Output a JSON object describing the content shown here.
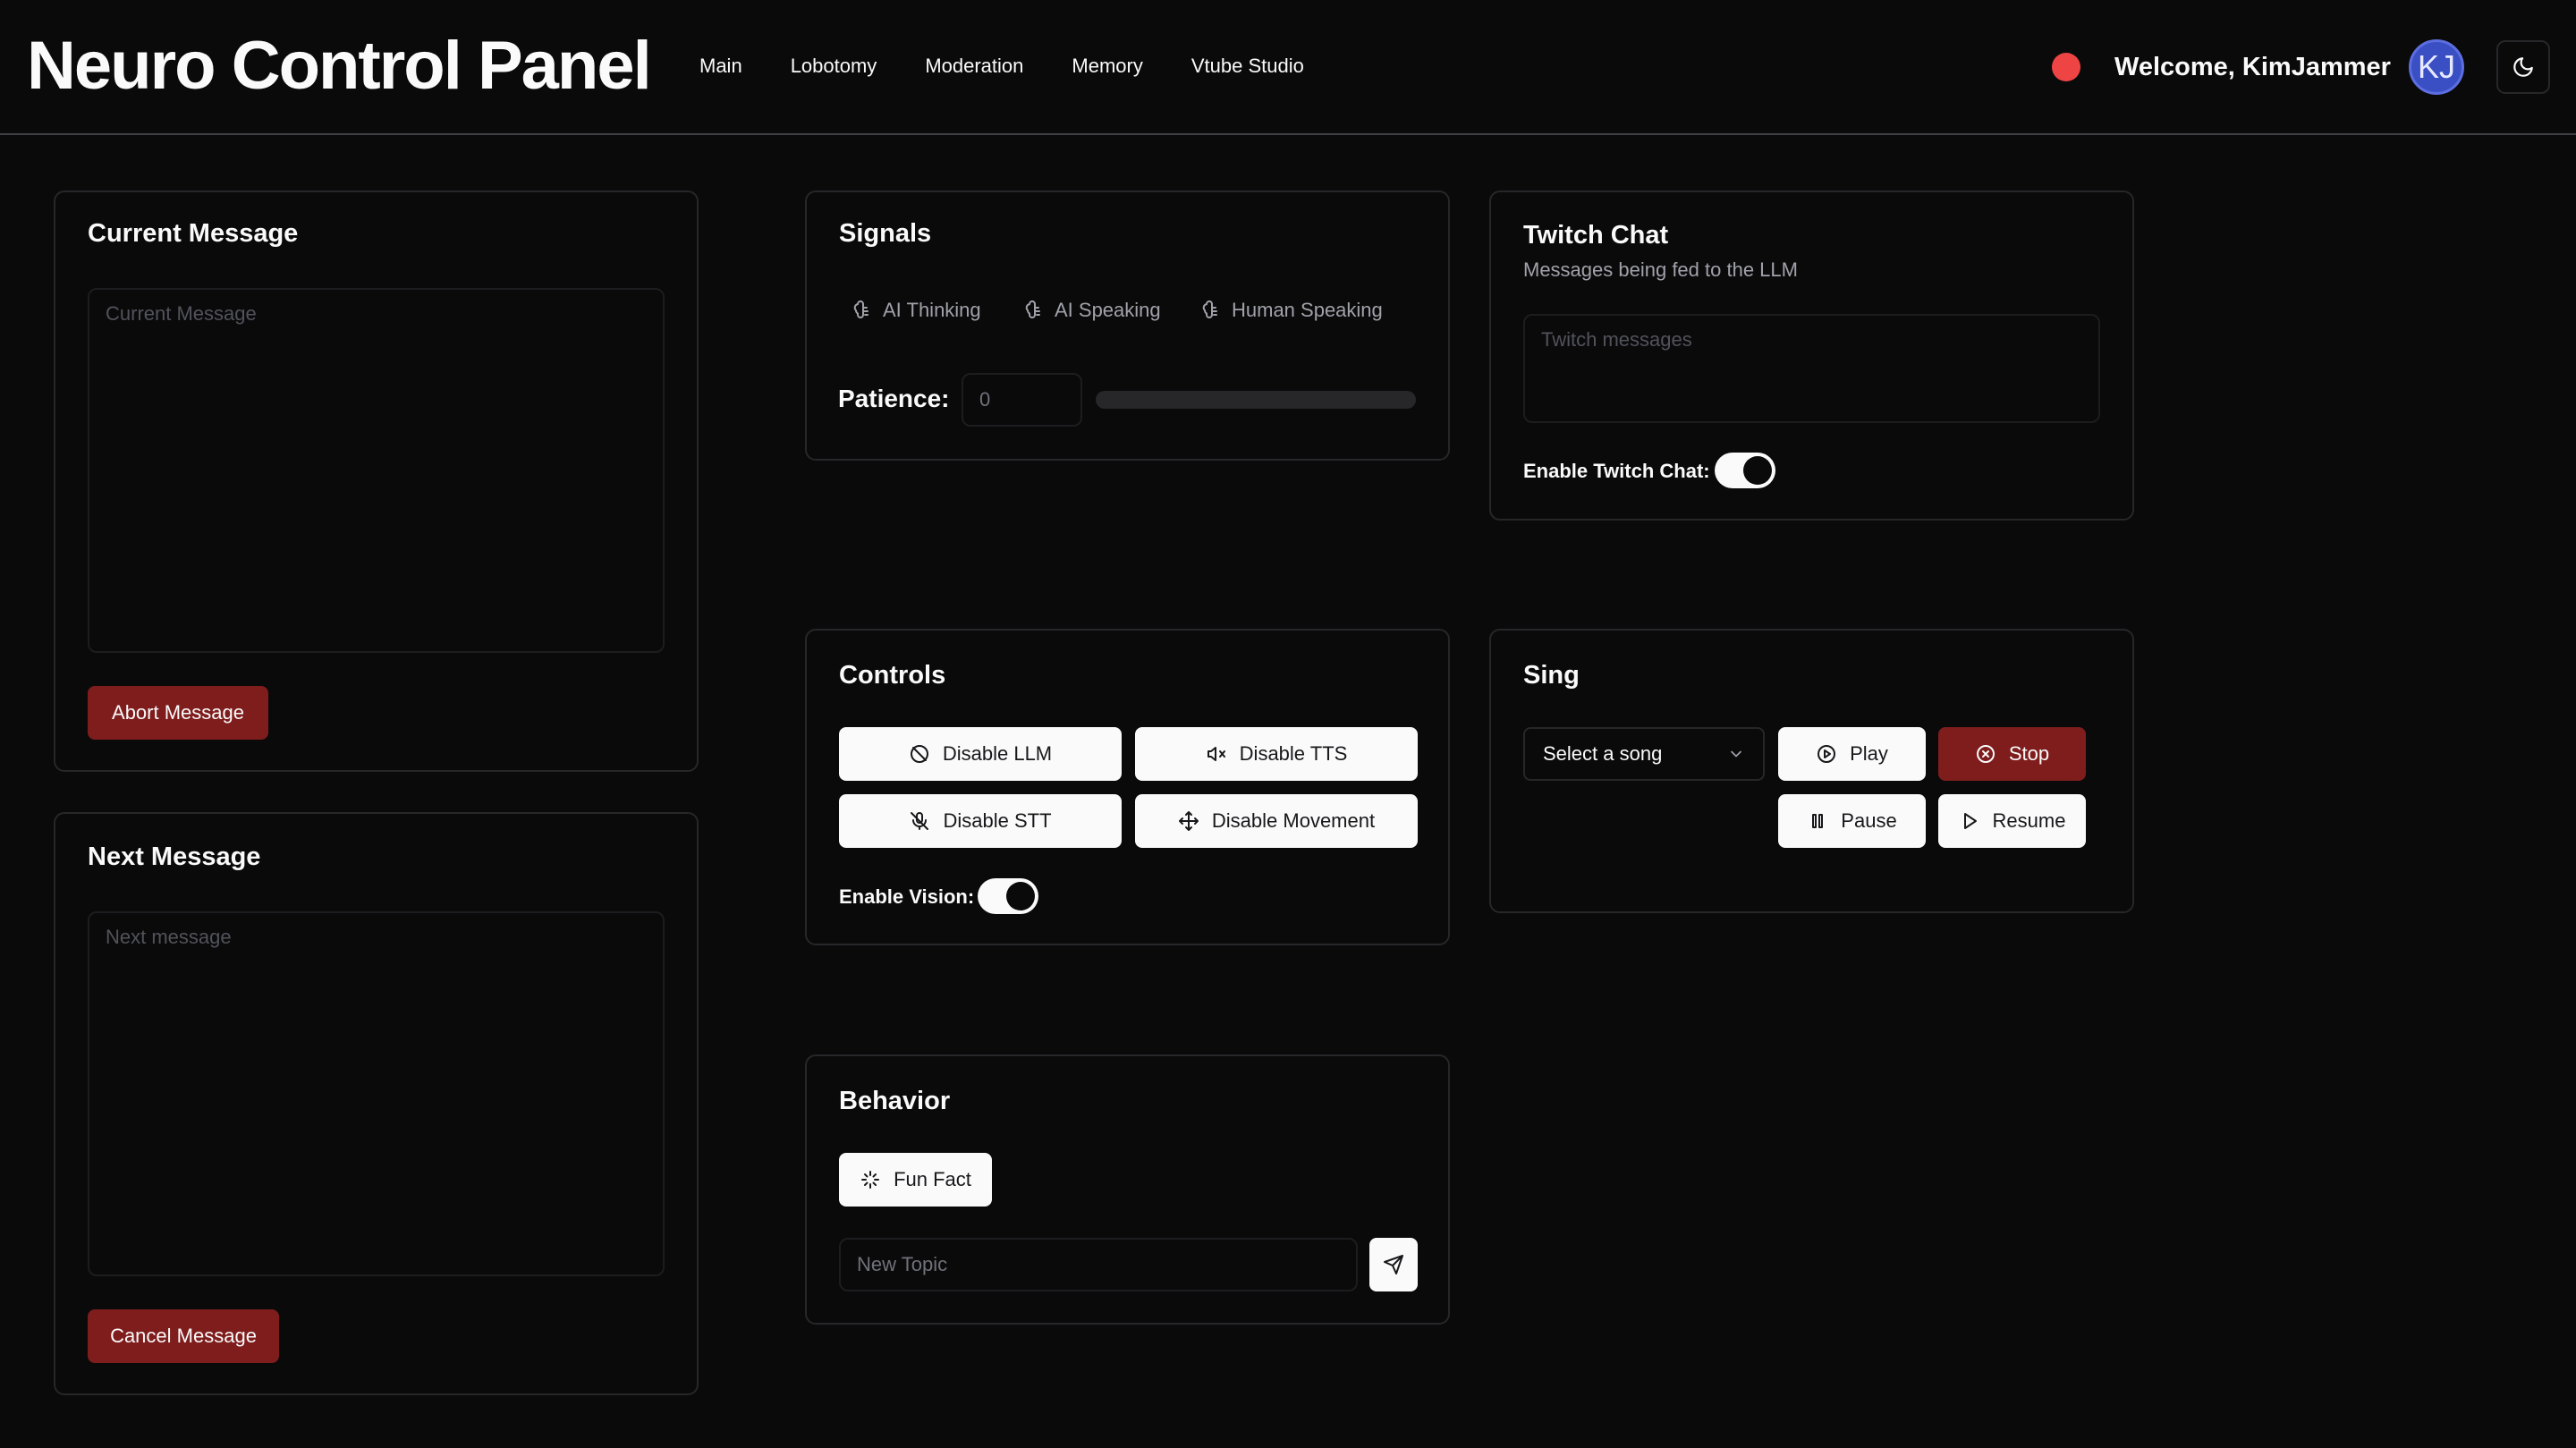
{
  "header": {
    "title": "Neuro Control Panel",
    "nav": [
      "Main",
      "Lobotomy",
      "Moderation",
      "Memory",
      "Vtube Studio"
    ],
    "welcome": "Welcome, KimJammer",
    "avatar_initials": "KJ",
    "status_color": "#ef4444"
  },
  "current_message": {
    "title": "Current Message",
    "placeholder": "Current Message",
    "abort_label": "Abort Message"
  },
  "next_message": {
    "title": "Next Message",
    "placeholder": "Next message",
    "cancel_label": "Cancel Message"
  },
  "signals": {
    "title": "Signals",
    "items": [
      {
        "label": "AI Thinking",
        "icon": "brain-icon"
      },
      {
        "label": "AI Speaking",
        "icon": "brain-icon"
      },
      {
        "label": "Human Speaking",
        "icon": "brain-icon"
      }
    ],
    "patience_label": "Patience:",
    "patience_value": "0",
    "patience_progress": 0
  },
  "twitch_chat": {
    "title": "Twitch Chat",
    "subtitle": "Messages being fed to the LLM",
    "placeholder": "Twitch messages",
    "enable_label": "Enable Twitch Chat:",
    "enabled": true
  },
  "controls": {
    "title": "Controls",
    "buttons": [
      {
        "label": "Disable LLM",
        "icon": "brain-off-icon"
      },
      {
        "label": "Disable TTS",
        "icon": "speaker-off-icon"
      },
      {
        "label": "Disable STT",
        "icon": "mic-off-icon"
      },
      {
        "label": "Disable Movement",
        "icon": "move-icon"
      }
    ],
    "vision_label": "Enable Vision:",
    "vision_enabled": true
  },
  "sing": {
    "title": "Sing",
    "select_value": "Select a song",
    "play_label": "Play",
    "stop_label": "Stop",
    "pause_label": "Pause",
    "resume_label": "Resume"
  },
  "behavior": {
    "title": "Behavior",
    "fun_fact_label": "Fun Fact",
    "topic_placeholder": "New Topic"
  }
}
